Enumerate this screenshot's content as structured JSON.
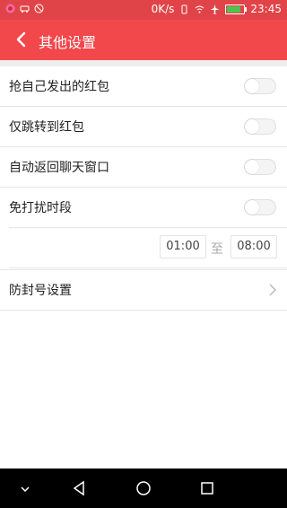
{
  "status_bar": {
    "speed": "0K/s",
    "time": "23:45"
  },
  "app_bar": {
    "title": "其他设置",
    "back_icon": "chevron-left-icon",
    "color": "#f2474b"
  },
  "settings": {
    "grab_own_red_packet": {
      "label": "抢自己发出的红包",
      "enabled": false
    },
    "jump_to_red_packet_only": {
      "label": "仅跳转到红包",
      "enabled": false
    },
    "auto_return_chat": {
      "label": "自动返回聊天窗口",
      "enabled": false
    },
    "do_not_disturb": {
      "label": "免打扰时段",
      "enabled": false,
      "from": "01:00",
      "to_label": "至",
      "to": "08:00"
    },
    "anti_ban": {
      "label": "防封号设置"
    }
  },
  "nav_bar": {
    "items": [
      "chevron-down-icon",
      "back-triangle-icon",
      "home-circle-icon",
      "recents-square-icon"
    ]
  }
}
